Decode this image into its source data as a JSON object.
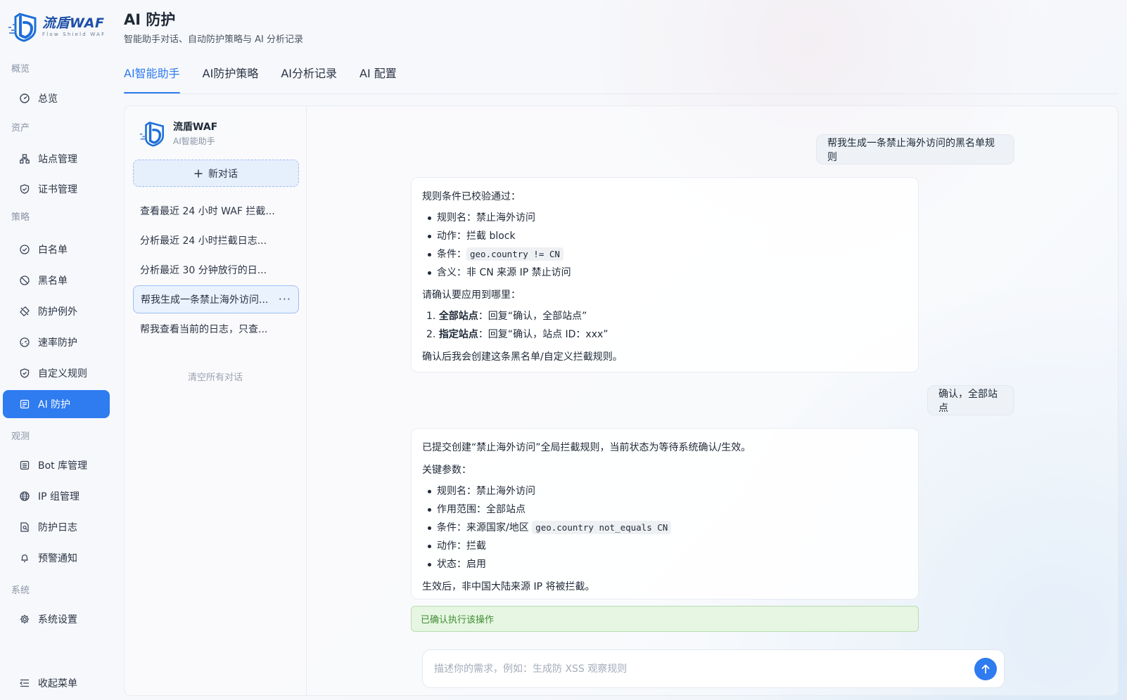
{
  "brand": {
    "name": "流盾WAF",
    "tagline": "Flow Shield WAF"
  },
  "sidebar": {
    "sections": {
      "overview": "概览",
      "assets": "资产",
      "strategy": "策略",
      "observe": "观测",
      "system": "系统"
    },
    "items": [
      {
        "label": "总览",
        "icon": "dashboard-icon"
      },
      {
        "label": "站点管理",
        "icon": "sitemap-icon"
      },
      {
        "label": "证书管理",
        "icon": "shield-check-icon"
      },
      {
        "label": "白名单",
        "icon": "check-circle-icon"
      },
      {
        "label": "黑名单",
        "icon": "ban-icon"
      },
      {
        "label": "防护例外",
        "icon": "exception-icon"
      },
      {
        "label": "速率防护",
        "icon": "speed-icon"
      },
      {
        "label": "自定义规则",
        "icon": "shield-icon"
      },
      {
        "label": "AI 防护",
        "icon": "ai-icon"
      },
      {
        "label": "Bot 库管理",
        "icon": "bot-icon"
      },
      {
        "label": "IP 组管理",
        "icon": "globe-icon"
      },
      {
        "label": "防护日志",
        "icon": "log-icon"
      },
      {
        "label": "预警通知",
        "icon": "bell-icon"
      },
      {
        "label": "系统设置",
        "icon": "gear-icon"
      }
    ],
    "collapse": "收起菜单"
  },
  "header": {
    "title": "AI 防护",
    "subtitle": "智能助手对话、自动防护策略与 AI 分析记录"
  },
  "tabs": [
    "AI智能助手",
    "AI防护策略",
    "AI分析记录",
    "AI 配置"
  ],
  "assistant": {
    "name": "流盾WAF",
    "role": "AI智能助手"
  },
  "conversations": {
    "new_label": "新对话",
    "items": [
      "查看最近 24 小时 WAF 拦截...",
      "分析最近 24 小时拦截日志...",
      "分析最近 30 分钟放行的日...",
      "帮我生成一条禁止海外访问...",
      "帮我查看当前的日志，只查..."
    ],
    "more": "···",
    "clear_label": "清空所有对话"
  },
  "chat": {
    "user1": "帮我生成一条禁止海外访问的黑名单规则",
    "ai1": {
      "intro": "规则条件已校验通过：",
      "bullets": [
        {
          "label": "规则名：",
          "value": "禁止海外访问"
        },
        {
          "label": "动作：",
          "value": "拦截 block"
        },
        {
          "label": "条件：",
          "code": "geo.country != CN"
        },
        {
          "label": "含义：",
          "value": "非 CN 来源 IP 禁止访问"
        }
      ],
      "question": "请确认要应用到哪里：",
      "options": [
        {
          "num": "1.",
          "bold": "全部站点",
          "rest": "：回复“确认，全部站点”"
        },
        {
          "num": "2.",
          "bold": "指定站点",
          "rest": "：回复“确认，站点 ID：xxx”"
        }
      ],
      "outro": "确认后我会创建这条黑名单/自定义拦截规则。"
    },
    "user2": "确认，全部站点",
    "ai2": {
      "intro": "已提交创建“禁止海外访问”全局拦截规则，当前状态为等待系统确认/生效。",
      "params_title": "关键参数：",
      "bullets": [
        {
          "label": "规则名：",
          "value": "禁止海外访问"
        },
        {
          "label": "作用范围：",
          "value": "全部站点"
        },
        {
          "label": "条件：",
          "value": "来源国家/地区",
          "code": "geo.country not_equals CN"
        },
        {
          "label": "动作：",
          "value": "拦截"
        },
        {
          "label": "状态：",
          "value": "启用"
        }
      ],
      "outro": "生效后，非中国大陆来源 IP 将被拦截。"
    },
    "confirm_status": "已确认执行该操作",
    "input_placeholder": "描述你的需求，例如：生成防 XSS 观察规则"
  },
  "colors": {
    "accent": "#2f7bf0",
    "success": "#3d8f32",
    "brand": "#1e50a8"
  }
}
